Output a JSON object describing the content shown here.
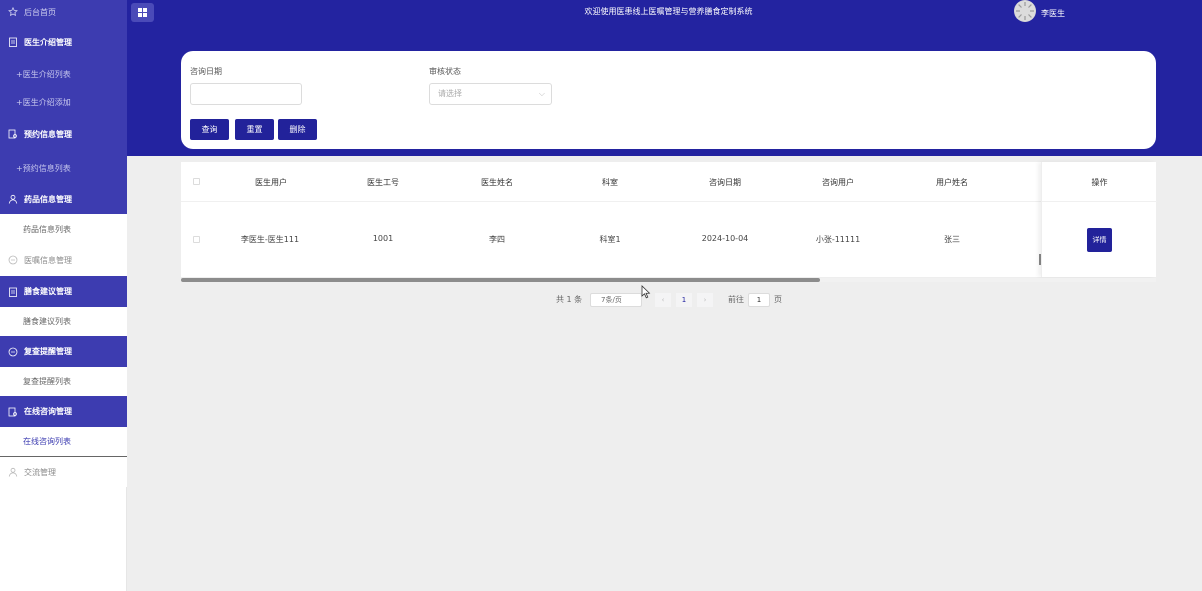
{
  "sidebar": {
    "home": "后台首页",
    "groups": [
      {
        "label": "医生介绍管理",
        "subs": [
          "+医生介绍列表",
          "+医生介绍添加"
        ]
      },
      {
        "label": "预约信息管理",
        "subs": [
          "+预约信息列表"
        ]
      },
      {
        "label": "药品信息管理",
        "subs": [
          "药品信息列表"
        ]
      }
    ],
    "medical_advice": "医嘱信息管理",
    "diet": {
      "label": "膳食建议管理",
      "sub": "膳食建议列表"
    },
    "review": {
      "label": "复查提醒管理",
      "sub": "复查提醒列表"
    },
    "consult": {
      "label": "在线咨询管理",
      "sub": "在线咨询列表"
    },
    "communication": "交流管理"
  },
  "header": {
    "title": "欢迎使用医患线上医嘱管理与营养膳食定制系统",
    "username": "李医生"
  },
  "search": {
    "date_label": "咨询日期",
    "status_label": "审核状态",
    "status_placeholder": "请选择",
    "query_btn": "查询",
    "reset_btn": "重置",
    "delete_btn": "删除"
  },
  "table": {
    "columns": [
      "医生用户",
      "医生工号",
      "医生姓名",
      "科室",
      "咨询日期",
      "咨询用户",
      "用户姓名"
    ],
    "action_col": "操作",
    "rows": [
      {
        "doctor_user": "李医生-医生111",
        "doctor_no": "1001",
        "doctor_name": "李四",
        "dept": "科室1",
        "date": "2024-10-04",
        "consult_user": "小张-11111",
        "user_name": "张三",
        "action": "详情"
      }
    ],
    "scroll_fraction": 0.655
  },
  "pagination": {
    "total": "共 1 条",
    "page_size": "7条/页",
    "prev": "‹",
    "current": "1",
    "next": "›",
    "goto_label": "前往",
    "goto_value": "1",
    "page_unit": "页"
  },
  "colors": {
    "primary": "#2323a0",
    "sidebar_group": "#3d3cb0"
  }
}
